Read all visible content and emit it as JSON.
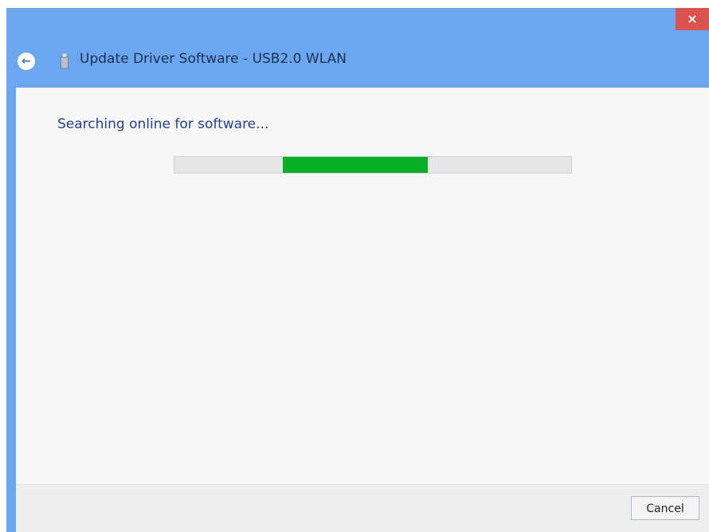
{
  "window": {
    "title": "Update Driver Software - USB2.0 WLAN",
    "close_label": "×",
    "back_label": "←",
    "titlebar_color": "#6aa7ee"
  },
  "main": {
    "heading": "Searching online for software...",
    "progress": {
      "state": "indeterminate",
      "fill_color": "#06b025"
    }
  },
  "footer": {
    "cancel_label": "Cancel"
  }
}
